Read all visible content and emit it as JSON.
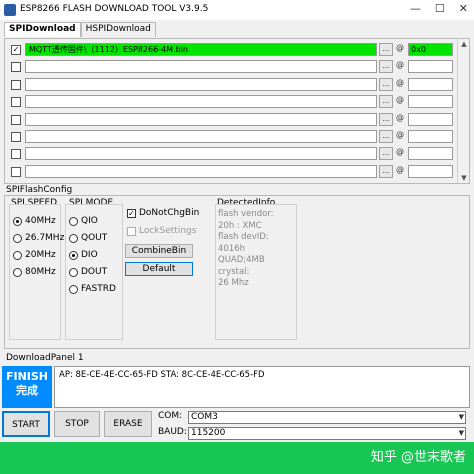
{
  "window": {
    "title": "ESP8266 FLASH DOWNLOAD TOOL V3.9.5",
    "minimize": "—",
    "maximize": "☐",
    "close": "✕"
  },
  "tabs": [
    {
      "label": "SPIDownload",
      "active": true
    },
    {
      "label": "HSPIDownload",
      "active": false
    }
  ],
  "files": [
    {
      "checked": true,
      "path": "MQTT透传固件\\（1112）ESP8266-4M.bin",
      "browse": "...",
      "at": "@",
      "address": "0x0",
      "highlight": true
    },
    {
      "checked": false,
      "path": "",
      "browse": "...",
      "at": "@",
      "address": ""
    },
    {
      "checked": false,
      "path": "",
      "browse": "...",
      "at": "@",
      "address": ""
    },
    {
      "checked": false,
      "path": "",
      "browse": "...",
      "at": "@",
      "address": ""
    },
    {
      "checked": false,
      "path": "",
      "browse": "...",
      "at": "@",
      "address": ""
    },
    {
      "checked": false,
      "path": "",
      "browse": "...",
      "at": "@",
      "address": ""
    },
    {
      "checked": false,
      "path": "",
      "browse": "...",
      "at": "@",
      "address": ""
    },
    {
      "checked": false,
      "path": "",
      "browse": "...",
      "at": "@",
      "address": ""
    }
  ],
  "spi_flash_config": {
    "section_label": "SPIFlashConfig",
    "spi_speed": {
      "title": "SPI SPEED",
      "options": [
        "40MHz",
        "26.7MHz",
        "20MHz",
        "80MHz"
      ],
      "selected": "40MHz"
    },
    "spi_mode": {
      "title": "SPI MODE",
      "options": [
        "QIO",
        "QOUT",
        "DIO",
        "DOUT",
        "FASTRD"
      ],
      "selected": "DIO"
    },
    "do_not_chg_bin": {
      "label": "DoNotChgBin",
      "checked": true
    },
    "lock_settings": {
      "label": "LockSettings",
      "checked": false
    },
    "combine_bin_button": "CombineBin",
    "default_button": "Default",
    "detected_info": {
      "title": "DetectedInfo",
      "text": "flash vendor:\n20h : XMC\nflash devID:\n4016h\nQUAD;4MB\ncrystal:\n26 Mhz"
    }
  },
  "download_panel": {
    "label": "DownloadPanel 1",
    "status_line1": "FINISH",
    "status_line2": "完成",
    "status_color": "#008cff",
    "log": "AP:  8E-CE-4E-CC-65-FD   STA:  8C-CE-4E-CC-65-FD",
    "start_button": "START",
    "stop_button": "STOP",
    "erase_button": "ERASE",
    "com_label": "COM:",
    "com_value": "COM3",
    "baud_label": "BAUD:",
    "baud_value": "115200"
  },
  "statusbar": {
    "color": "#17c653",
    "watermark": "知乎 @世末歌者"
  }
}
